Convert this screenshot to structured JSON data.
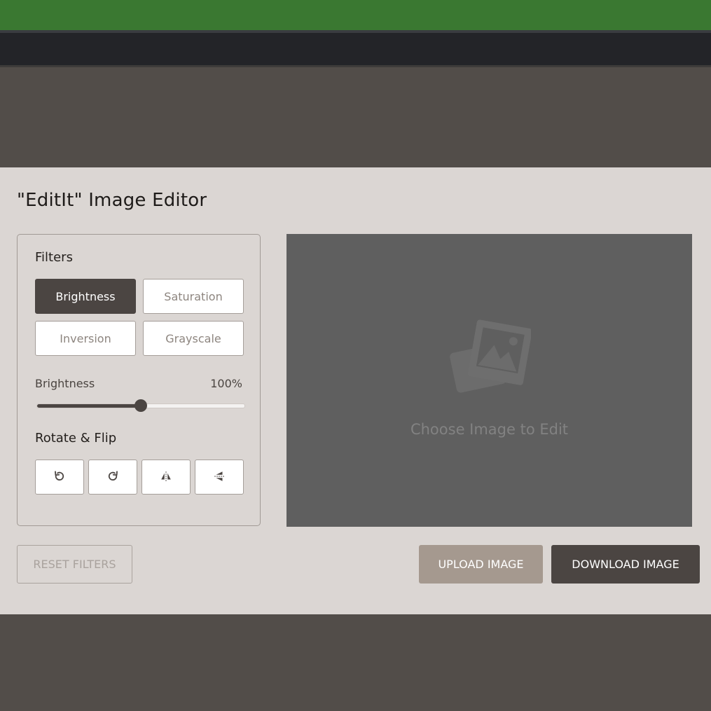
{
  "app": {
    "title": "\"EditIt\" Image Editor"
  },
  "filters": {
    "heading": "Filters",
    "buttons": [
      {
        "label": "Brightness",
        "active": true
      },
      {
        "label": "Saturation",
        "active": false
      },
      {
        "label": "Inversion",
        "active": false
      },
      {
        "label": "Grayscale",
        "active": false
      }
    ]
  },
  "slider": {
    "name": "Brightness",
    "value_text": "100%",
    "fraction": 0.5
  },
  "rotate": {
    "heading": "Rotate & Flip",
    "buttons": [
      "rotate-left-icon",
      "rotate-right-icon",
      "flip-horizontal-icon",
      "flip-vertical-icon"
    ]
  },
  "preview": {
    "placeholder": "Choose Image to Edit",
    "icon": "image-placeholder-icon"
  },
  "actions": {
    "reset": "RESET FILTERS",
    "upload": "UPLOAD IMAGE",
    "download": "DOWNLOAD IMAGE"
  },
  "colors": {
    "accent": "#4b4542",
    "upload": "#a5998f",
    "top_bar": "#3a7831",
    "nav_bar": "#232428",
    "panel": "#dbd6d3",
    "preview_bg": "#5f5f5f"
  }
}
